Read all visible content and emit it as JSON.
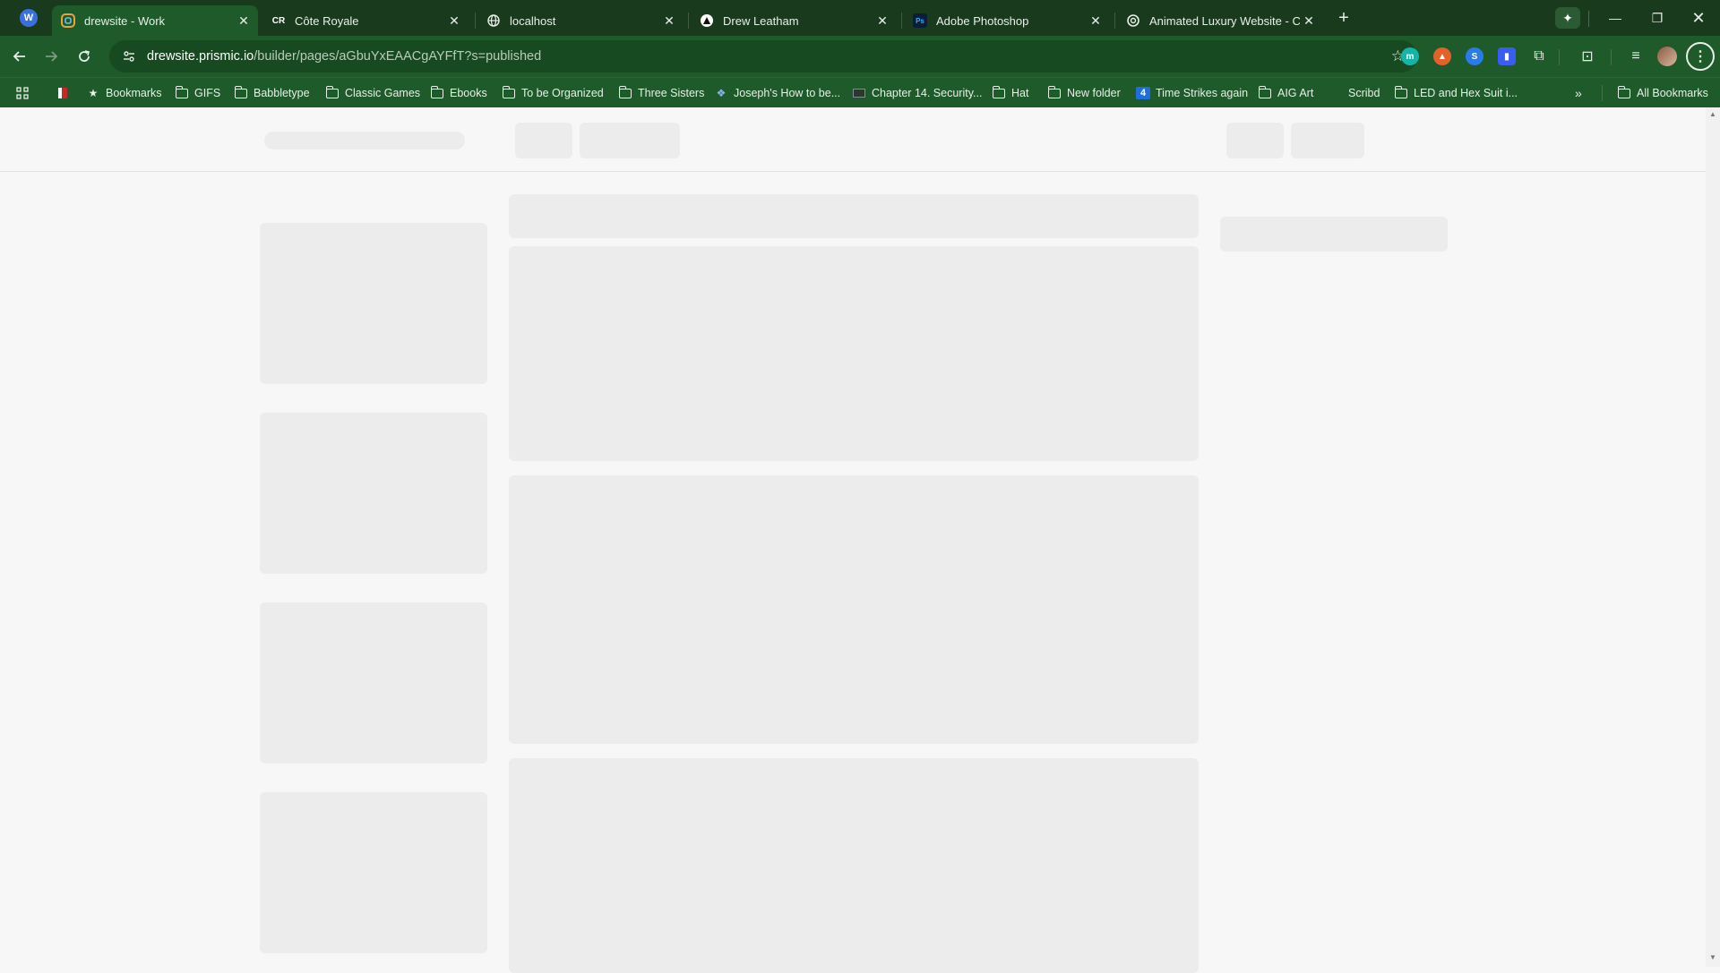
{
  "browser": {
    "profile_letter": "W",
    "tabs": [
      {
        "title": "drewsite - Work",
        "favicon": "prismic-icon",
        "active": true
      },
      {
        "title": "Côte Royale",
        "favicon_text": "CR"
      },
      {
        "title": "localhost",
        "favicon": "globe-icon"
      },
      {
        "title": "Drew Leatham",
        "favicon": "triangle-logo-icon"
      },
      {
        "title": "Adobe Photoshop",
        "favicon_text": "Ps"
      },
      {
        "title": "Animated Luxury Website - Cou",
        "favicon": "openai-icon"
      }
    ],
    "address": {
      "domain": "drewsite.prismic.io",
      "path": "/builder/pages/aGbuYxEAACgAYFfT?s=published"
    },
    "bookmarks": [
      {
        "label": "",
        "icon": "flag-icon"
      },
      {
        "label": "Bookmarks",
        "icon": "star-icon"
      },
      {
        "label": "GIFS",
        "icon": "folder-icon"
      },
      {
        "label": "Babbletype",
        "icon": "folder-icon"
      },
      {
        "label": "Classic Games",
        "icon": "folder-icon"
      },
      {
        "label": "Ebooks",
        "icon": "folder-icon"
      },
      {
        "label": "To be Organized",
        "icon": "folder-icon"
      },
      {
        "label": "Three Sisters",
        "icon": "folder-icon"
      },
      {
        "label": "Joseph's How to be...",
        "icon": "puzzle-icon"
      },
      {
        "label": "Chapter 14. Security...",
        "icon": "book-icon"
      },
      {
        "label": "Hat",
        "icon": "folder-icon"
      },
      {
        "label": "New folder",
        "icon": "folder-icon"
      },
      {
        "label": "Time Strikes again",
        "icon": "four-icon"
      },
      {
        "label": "AIG Art",
        "icon": "folder-icon"
      },
      {
        "label": "Scribd",
        "icon": ""
      },
      {
        "label": "LED and Hex Suit i...",
        "icon": "folder-icon"
      }
    ],
    "more_bookmarks": "»",
    "all_bookmarks": "All Bookmarks"
  },
  "colors": {
    "tabstrip": "#1a3a1e",
    "toolbar": "#1f5a2a",
    "skeleton": "#ececec",
    "page_bg": "#f7f7f7"
  }
}
